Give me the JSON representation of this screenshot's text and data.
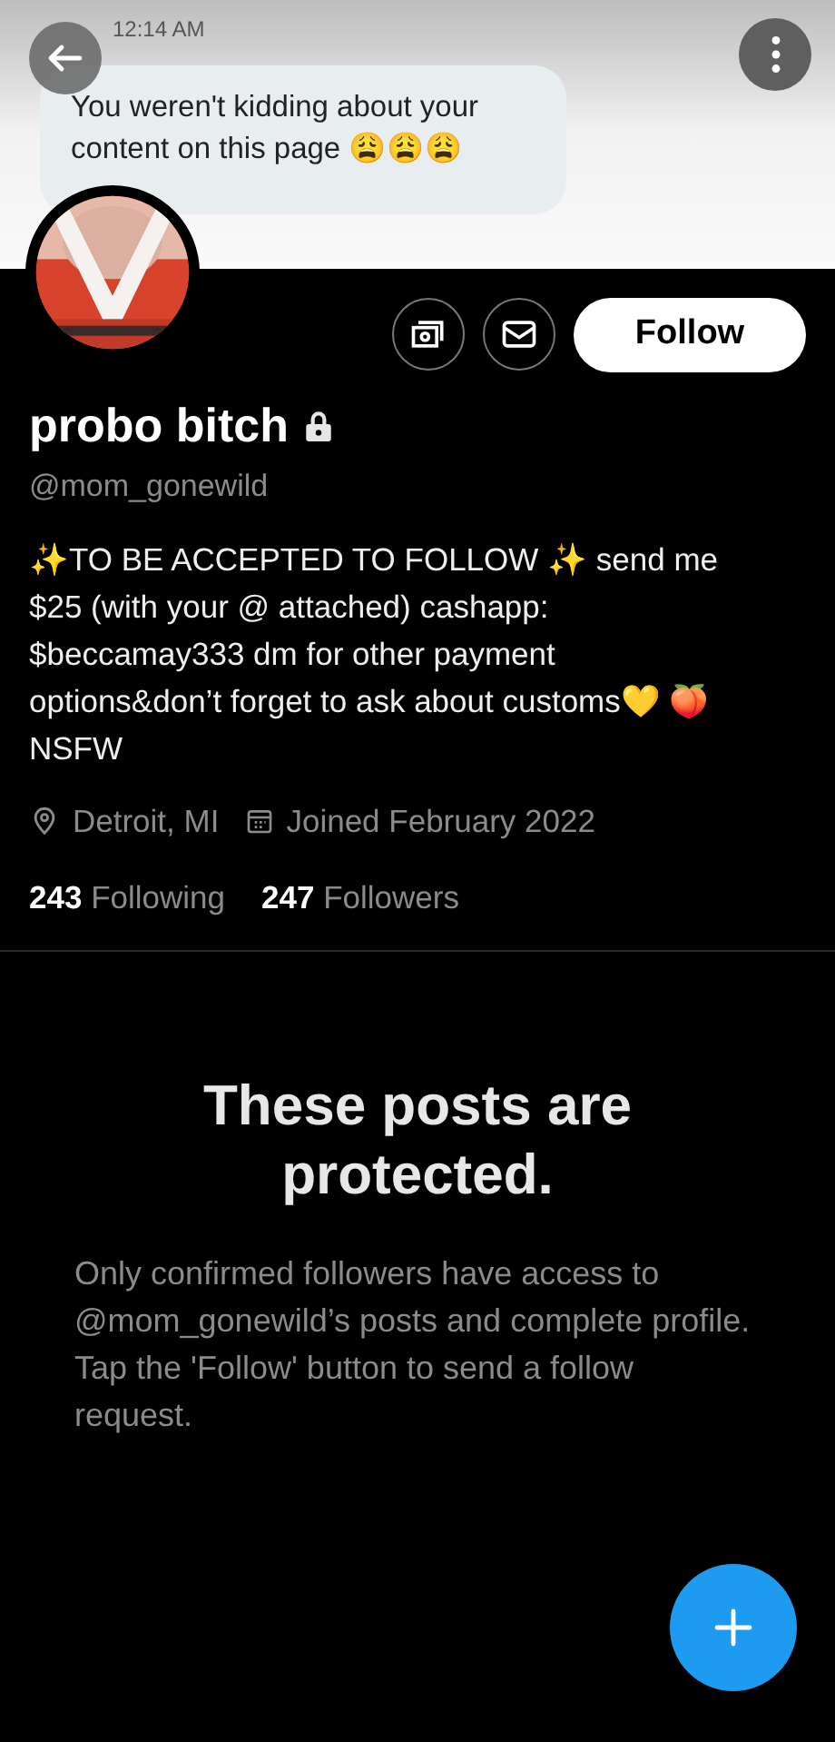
{
  "banner": {
    "kind": "message-screenshot",
    "time": "12:14 AM",
    "message": "You weren't kidding about your content on this page 😩😩😩"
  },
  "profile": {
    "name": "probo bitch",
    "protected": true,
    "handle": "@mom_gonewild",
    "bio": "✨TO BE ACCEPTED TO FOLLOW ✨ send me $25 (with your @ attached) cashapp: $beccamay333 dm for other payment options&don’t forget to ask about customs💛 🍑\nNSFW",
    "location": "Detroit, MI",
    "joined": "Joined February 2022",
    "following": "**243** Following",
    "followers": "**247** Followers"
  },
  "actions": {
    "follow": "Follow"
  },
  "protected_notice": {
    "title": "These posts are protected.",
    "body": "Only confirmed followers have access to @mom_gonewild’s posts and complete profile. Tap the 'Follow' button to send a follow request."
  }
}
